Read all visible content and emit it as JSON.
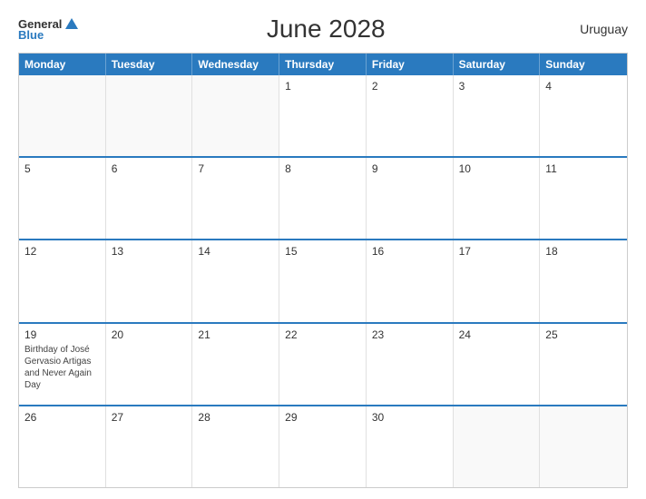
{
  "header": {
    "title": "June 2028",
    "country": "Uruguay",
    "logo": {
      "general": "General",
      "blue": "Blue"
    }
  },
  "weekdays": [
    "Monday",
    "Tuesday",
    "Wednesday",
    "Thursday",
    "Friday",
    "Saturday",
    "Sunday"
  ],
  "rows": [
    [
      {
        "day": "",
        "empty": true
      },
      {
        "day": "",
        "empty": true
      },
      {
        "day": "",
        "empty": true
      },
      {
        "day": "1",
        "empty": false
      },
      {
        "day": "2",
        "empty": false
      },
      {
        "day": "3",
        "empty": false
      },
      {
        "day": "4",
        "empty": false
      }
    ],
    [
      {
        "day": "5",
        "empty": false
      },
      {
        "day": "6",
        "empty": false
      },
      {
        "day": "7",
        "empty": false
      },
      {
        "day": "8",
        "empty": false
      },
      {
        "day": "9",
        "empty": false
      },
      {
        "day": "10",
        "empty": false
      },
      {
        "day": "11",
        "empty": false
      }
    ],
    [
      {
        "day": "12",
        "empty": false
      },
      {
        "day": "13",
        "empty": false
      },
      {
        "day": "14",
        "empty": false
      },
      {
        "day": "15",
        "empty": false
      },
      {
        "day": "16",
        "empty": false
      },
      {
        "day": "17",
        "empty": false
      },
      {
        "day": "18",
        "empty": false
      }
    ],
    [
      {
        "day": "19",
        "empty": false,
        "event": "Birthday of José Gervasio Artigas and Never Again Day"
      },
      {
        "day": "20",
        "empty": false
      },
      {
        "day": "21",
        "empty": false
      },
      {
        "day": "22",
        "empty": false
      },
      {
        "day": "23",
        "empty": false
      },
      {
        "day": "24",
        "empty": false
      },
      {
        "day": "25",
        "empty": false
      }
    ],
    [
      {
        "day": "26",
        "empty": false
      },
      {
        "day": "27",
        "empty": false
      },
      {
        "day": "28",
        "empty": false
      },
      {
        "day": "29",
        "empty": false
      },
      {
        "day": "30",
        "empty": false
      },
      {
        "day": "",
        "empty": true
      },
      {
        "day": "",
        "empty": true
      }
    ]
  ]
}
